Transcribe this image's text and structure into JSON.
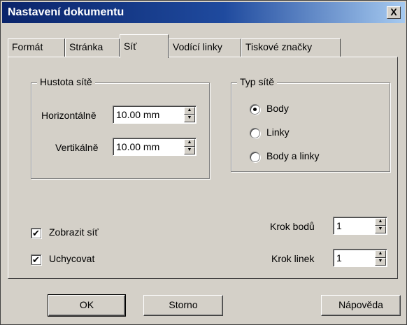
{
  "window": {
    "title": "Nastavení dokumentu",
    "close_glyph": "X"
  },
  "tabs": [
    {
      "label": "Formát"
    },
    {
      "label": "Stránka"
    },
    {
      "label": "Síť",
      "active": true
    },
    {
      "label": "Vodící linky"
    },
    {
      "label": "Tiskové značky"
    }
  ],
  "grid_density": {
    "title": "Hustota sítě",
    "horizontal": {
      "label": "Horizontálně",
      "value": "10.00 mm"
    },
    "vertical": {
      "label": "Vertikálně",
      "value": "10.00 mm"
    }
  },
  "grid_type": {
    "title": "Typ sítě",
    "options": [
      {
        "label": "Body",
        "selected": true
      },
      {
        "label": "Linky",
        "selected": false
      },
      {
        "label": "Body a linky",
        "selected": false
      }
    ]
  },
  "checkboxes": {
    "show_grid": {
      "label": "Zobrazit síť",
      "checked": true
    },
    "snap": {
      "label": "Uchycovat",
      "checked": true
    }
  },
  "steps": {
    "point_step": {
      "label": "Krok bodů",
      "value": "1"
    },
    "line_step": {
      "label": "Krok linek",
      "value": "1"
    }
  },
  "buttons": {
    "ok": "OK",
    "cancel": "Storno",
    "help": "Nápověda"
  },
  "glyphs": {
    "check": "✔",
    "up": "▲",
    "down": "▼"
  }
}
